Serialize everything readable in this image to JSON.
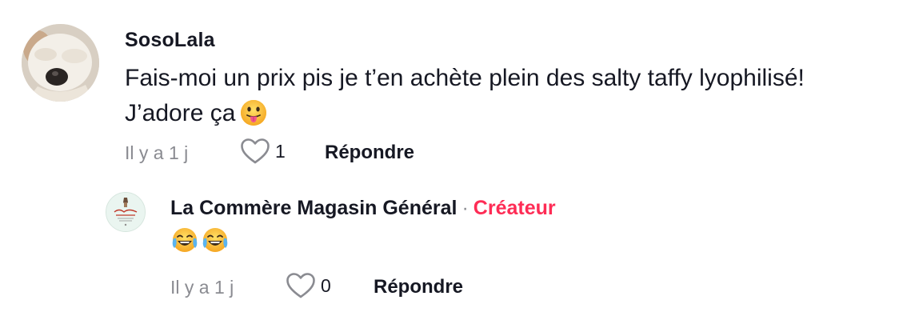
{
  "comment": {
    "username": "SosoLala",
    "text_line1": "Fais-moi un prix pis je t’en achète plein des salty taffy lyophilisé!",
    "text_line2": "J’adore ça",
    "emoji": "face-with-tongue",
    "time": "Il y a 1 j",
    "likes": "1",
    "reply_label": "Répondre"
  },
  "reply": {
    "username": "La Commère Magasin Général",
    "separator": "·",
    "badge": "Créateur",
    "emojis": [
      "face-with-tears-of-joy",
      "face-with-tears-of-joy"
    ],
    "time": "Il y a 1 j",
    "likes": "0",
    "reply_label": "Répondre"
  },
  "colors": {
    "creator_badge": "#fe2c55",
    "meta_gray": "#8a8b91",
    "text": "#161823"
  }
}
